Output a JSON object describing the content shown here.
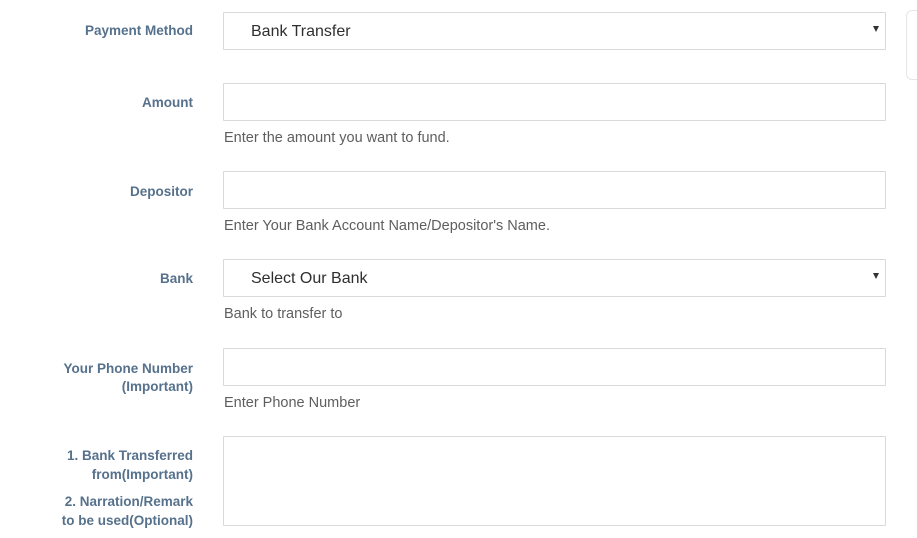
{
  "form": {
    "payment_method": {
      "label": "Payment Method",
      "value": "Bank Transfer"
    },
    "amount": {
      "label": "Amount",
      "value": "",
      "help": "Enter the amount you want to fund."
    },
    "depositor": {
      "label": "Depositor",
      "value": "",
      "help": "Enter Your Bank Account Name/Depositor's Name."
    },
    "bank": {
      "label": "Bank",
      "value": "Select Our Bank",
      "help": "Bank to transfer to"
    },
    "phone": {
      "label_line1": "Your Phone Number",
      "label_line2": "(Important)",
      "value": "",
      "help": "Enter Phone Number"
    },
    "details": {
      "label_line1": "1. Bank Transferred",
      "label_line2": "from(Important)",
      "label_line3": "2. Narration/Remark",
      "label_line4": "to be used(Optional)",
      "value": ""
    }
  },
  "icons": {
    "dropdown": "caret-down-icon"
  },
  "colors": {
    "label": "#56718c",
    "border": "#d9d9d9",
    "help_text": "#5e5e5e"
  }
}
